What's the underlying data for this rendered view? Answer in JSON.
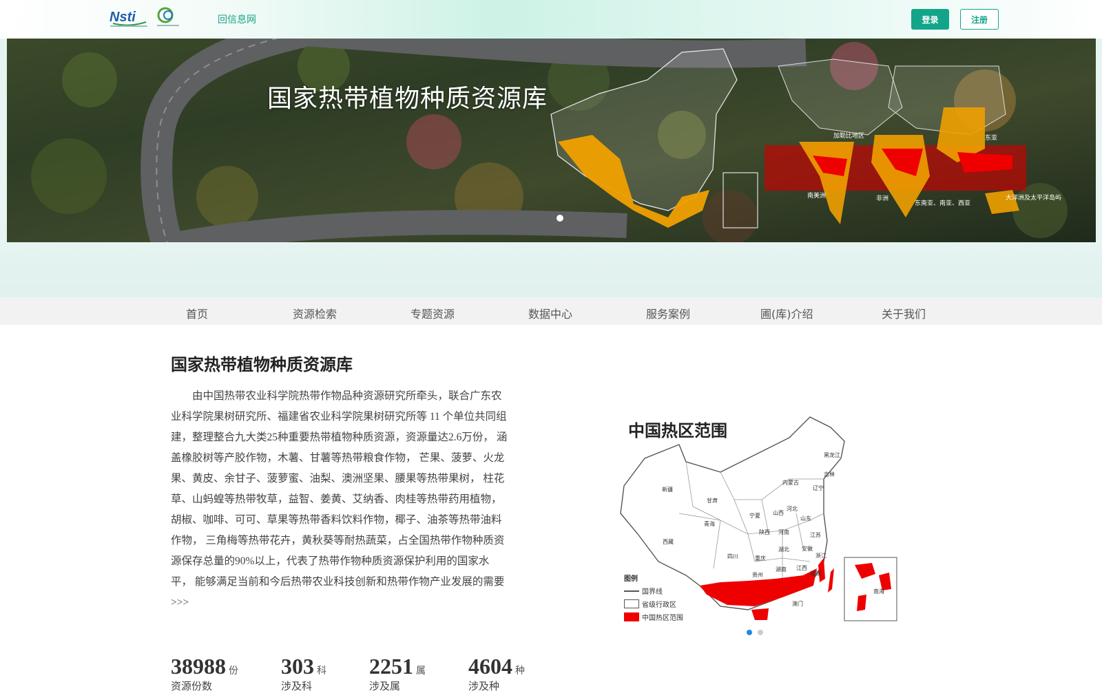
{
  "header": {
    "site_link": "回信息网",
    "login": "登录",
    "register": "注册"
  },
  "banner": {
    "title": "国家热带植物种质资源库",
    "map_labels": [
      "加勒比地区",
      "东亚",
      "南美洲",
      "非洲",
      "东南亚、南亚、西亚",
      "大洋洲及太平洋岛屿"
    ]
  },
  "nav": [
    "首页",
    "资源检索",
    "专题资源",
    "数据中心",
    "服务案例",
    "圃(库)介绍",
    "关于我们"
  ],
  "content": {
    "title": "国家热带植物种质资源库",
    "description": "由中国热带农业科学院热带作物品种资源研究所牵头，联合广东农业科学院果树研究所、福建省农业科学院果树研究所等 11 个单位共同组建，整理整合九大类25种重要热带植物种质资源，资源量达2.6万份， 涵盖橡胶树等产胶作物，木薯、甘薯等热带粮食作物， 芒果、菠萝、火龙果、黄皮、余甘子、菠萝蜜、油梨、澳洲坚果、腰果等热带果树， 柱花草、山蚂蝗等热带牧草，益智、姜黄、艾纳香、肉桂等热带药用植物，胡椒、咖啡、可可、草果等热带香料饮料作物，椰子、油茶等热带油料作物， 三角梅等热带花卉，黄秋葵等耐热蔬菜，占全国热带作物种质资源保存总量的90%以上，代表了热带作物种质资源保护利用的国家水平， 能够满足当前和今后热带农业科技创新和热带作物产业发展的需要 >>>"
  },
  "stats": [
    {
      "value": "38988",
      "unit": "份",
      "label": "资源份数"
    },
    {
      "value": "303",
      "unit": "科",
      "label": "涉及科"
    },
    {
      "value": "2251",
      "unit": "属",
      "label": "涉及属"
    },
    {
      "value": "4604",
      "unit": "种",
      "label": "涉及种"
    }
  ],
  "map": {
    "title": "中国热区范围",
    "legend_title": "图例",
    "legend": [
      "国界线",
      "省级行政区",
      "中国热区范围"
    ],
    "province_labels": [
      "黑龙江",
      "吉林",
      "内蒙古",
      "辽宁",
      "新疆",
      "甘肃",
      "宁夏",
      "山西",
      "河北",
      "山东",
      "青海",
      "陕西",
      "河南",
      "江苏",
      "西藏",
      "四川",
      "湖北",
      "安徽",
      "重庆",
      "浙江",
      "贵州",
      "湖南",
      "江西",
      "福建",
      "南海",
      "澳门"
    ],
    "colors": {
      "hot_zone": "#ee0000",
      "dot_active": "#1e88e5",
      "dot_inactive": "#cccccc"
    }
  },
  "colors": {
    "accent": "#12a589"
  }
}
